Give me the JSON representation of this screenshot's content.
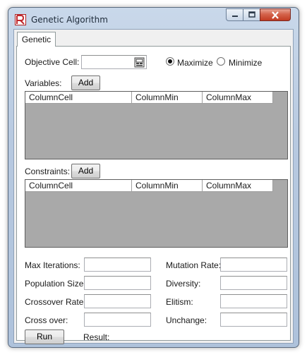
{
  "window": {
    "title": "Genetic Algorithm",
    "icon": "app-logo-icon"
  },
  "tabs": [
    {
      "label": "Genetic"
    }
  ],
  "objective": {
    "label": "Objective Cell:",
    "value": "",
    "picker_icon": "range-select-icon",
    "maximize_label": "Maximize",
    "minimize_label": "Minimize",
    "selected": "Maximize"
  },
  "variables": {
    "label": "Variables:",
    "add_label": "Add",
    "columns": [
      "ColumnCell",
      "ColumnMin",
      "ColumnMax"
    ],
    "rows": []
  },
  "constraints": {
    "label": "Constraints:",
    "add_label": "Add",
    "columns": [
      "ColumnCell",
      "ColumnMin",
      "ColumnMax"
    ],
    "rows": []
  },
  "params": {
    "max_iterations": {
      "label": "Max Iterations:",
      "value": ""
    },
    "population_size": {
      "label": "Population Size:",
      "value": ""
    },
    "crossover_rate": {
      "label": "Crossover Rate:",
      "value": ""
    },
    "cross_over": {
      "label": "Cross over:",
      "value": ""
    },
    "mutation_rate": {
      "label": "Mutation Rate:",
      "value": ""
    },
    "diversity": {
      "label": "Diversity:",
      "value": ""
    },
    "elitism": {
      "label": "Elitism:",
      "value": ""
    },
    "unchange": {
      "label": "Unchange:",
      "value": ""
    }
  },
  "run_label": "Run",
  "result_label": "Result:",
  "colors": {
    "grid_bg": "#a9a9a9",
    "close_button": "#c9452c",
    "logo_red": "#c0282d"
  }
}
